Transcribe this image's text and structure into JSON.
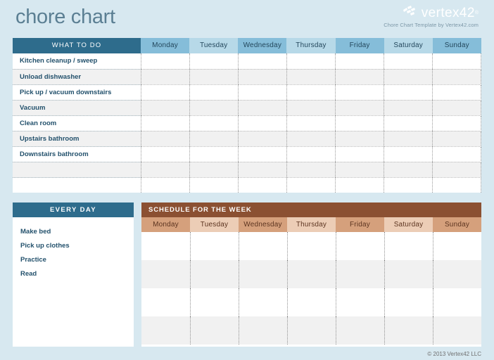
{
  "page": {
    "title": "chore chart",
    "background_color": "#d7e8f0"
  },
  "brand": {
    "logo_mark": "vertex42-logo-icon",
    "name": "vertex42",
    "trademark": "®",
    "subtitle": "Chore Chart Template by Vertex42.com"
  },
  "colors": {
    "header_blue": "#2e6c8c",
    "day_blue_dark": "#85bdd9",
    "day_blue_light": "#b7d9e8",
    "schedule_brown": "#8b5032",
    "day_tan_dark": "#d5a07c",
    "day_tan_light": "#eccdb6",
    "text_blue": "#23516c",
    "title_blue": "#5b7f93"
  },
  "chore_table": {
    "task_column_header": "WHAT TO DO",
    "day_headers": [
      "Monday",
      "Tuesday",
      "Wednesday",
      "Thursday",
      "Friday",
      "Saturday",
      "Sunday"
    ],
    "rows": [
      {
        "task": "Kitchen cleanup / sweep",
        "checks": [
          "",
          "",
          "",
          "",
          "",
          "",
          ""
        ]
      },
      {
        "task": "Unload dishwasher",
        "checks": [
          "",
          "",
          "",
          "",
          "",
          "",
          ""
        ]
      },
      {
        "task": "Pick up / vacuum downstairs",
        "checks": [
          "",
          "",
          "",
          "",
          "",
          "",
          ""
        ]
      },
      {
        "task": "Vacuum",
        "checks": [
          "",
          "",
          "",
          "",
          "",
          "",
          ""
        ]
      },
      {
        "task": "Clean room",
        "checks": [
          "",
          "",
          "",
          "",
          "",
          "",
          ""
        ]
      },
      {
        "task": "Upstairs bathroom",
        "checks": [
          "",
          "",
          "",
          "",
          "",
          "",
          ""
        ]
      },
      {
        "task": "Downstairs bathroom",
        "checks": [
          "",
          "",
          "",
          "",
          "",
          "",
          ""
        ]
      },
      {
        "task": "",
        "checks": [
          "",
          "",
          "",
          "",
          "",
          "",
          ""
        ]
      },
      {
        "task": "",
        "checks": [
          "",
          "",
          "",
          "",
          "",
          "",
          ""
        ]
      }
    ]
  },
  "every_day": {
    "header": "EVERY DAY",
    "items": [
      "Make bed",
      "Pick up clothes",
      "Practice",
      "Read"
    ]
  },
  "schedule": {
    "header": "SCHEDULE FOR THE WEEK",
    "day_headers": [
      "Monday",
      "Tuesday",
      "Wednesday",
      "Thursday",
      "Friday",
      "Saturday",
      "Sunday"
    ],
    "rows": [
      [
        "",
        "",
        "",
        "",
        "",
        "",
        ""
      ],
      [
        "",
        "",
        "",
        "",
        "",
        "",
        ""
      ],
      [
        "",
        "",
        "",
        "",
        "",
        "",
        ""
      ],
      [
        "",
        "",
        "",
        "",
        "",
        "",
        ""
      ]
    ]
  },
  "footer": {
    "copyright": "© 2013 Vertex42 LLC"
  }
}
